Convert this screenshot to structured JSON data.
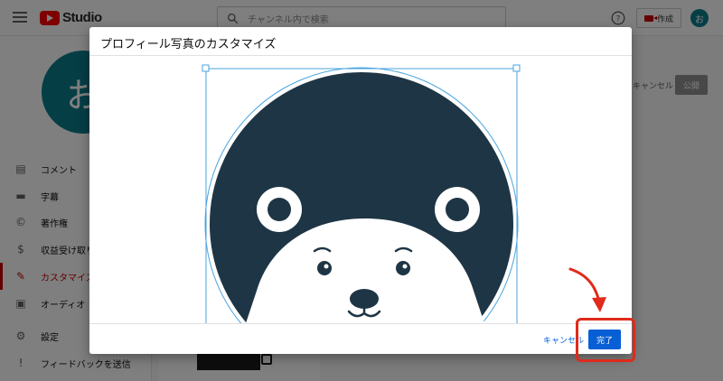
{
  "topbar": {
    "logo_text": "Studio",
    "search_placeholder": "チャンネル内で検索",
    "create_label": "作成",
    "avatar_letter": "お"
  },
  "sidebar": {
    "avatar_letter": "お",
    "items": [
      {
        "label": "コメント",
        "icon": "comment-icon"
      },
      {
        "label": "字幕",
        "icon": "subtitles-icon"
      },
      {
        "label": "著作権",
        "icon": "copyright-icon"
      },
      {
        "label": "収益受け取り",
        "icon": "dollar-icon"
      },
      {
        "label": "カスタマイズ",
        "icon": "magic-wand-icon",
        "active": true
      },
      {
        "label": "オーディオ ラ",
        "icon": "audio-library-icon"
      },
      {
        "label": "設定",
        "icon": "gear-icon"
      },
      {
        "label": "フィードバックを送信",
        "icon": "feedback-icon"
      }
    ]
  },
  "page": {
    "cancel_label": "キャンセル",
    "publish_label": "公開"
  },
  "dialog": {
    "title": "プロフィール写真のカスタマイズ",
    "cancel_label": "キャンセル",
    "done_label": "完了"
  },
  "colors": {
    "accent": "#065fd4",
    "brand_red": "#ff0000",
    "crop_frame": "#4aa3df",
    "bear_background": "#1e3545",
    "annotation_red": "#e02a1b"
  }
}
